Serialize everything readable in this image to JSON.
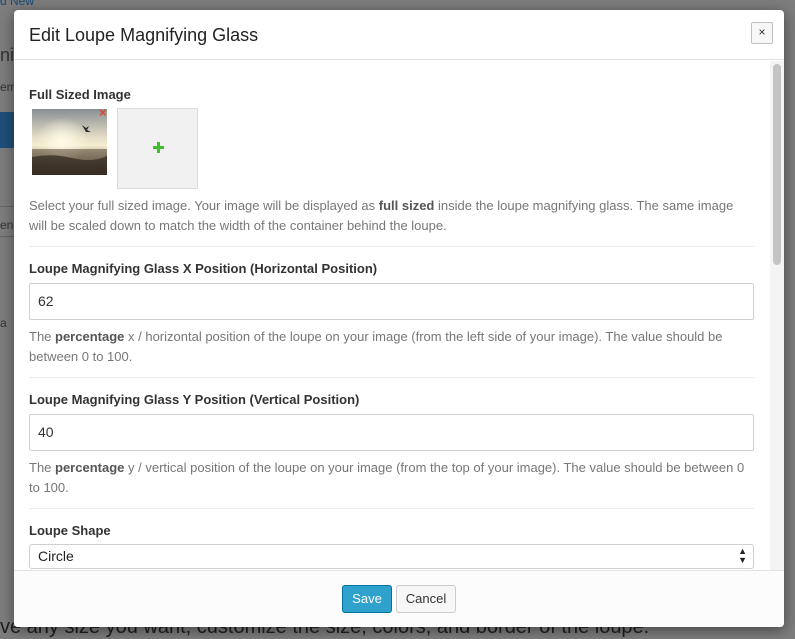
{
  "background": {
    "link_fragment": "d New",
    "fragments": [
      "ni",
      "em",
      "en",
      "a"
    ],
    "footer_text": "ve any size you want, customize the size, colors, and border of the loupe."
  },
  "modal": {
    "title": "Edit Loupe Magnifying Glass",
    "close_icon": "close-icon",
    "close_label": "×"
  },
  "image_section": {
    "label": "Full Sized Image",
    "remove_icon": "×",
    "description_parts": [
      "Select your full sized image. Your image will be displayed as ",
      "full sized",
      " inside the loupe magnifying glass. The same image will be scaled down to match the width of the container behind the loupe."
    ]
  },
  "x_position": {
    "label": "Loupe Magnifying Glass X Position (Horizontal Position)",
    "value": "62",
    "description_parts": [
      "The ",
      "percentage",
      " x / horizontal position of the loupe on your image (from the left side of your image). The value should be between 0 to 100."
    ]
  },
  "y_position": {
    "label": "Loupe Magnifying Glass Y Position (Vertical Position)",
    "value": "40",
    "description_parts": [
      "The ",
      "percentage",
      " y / vertical position of the loupe on your image (from the top of your image). The value should be between 0 to 100."
    ]
  },
  "shape": {
    "label": "Loupe Shape",
    "selected": "Circle"
  },
  "footer": {
    "save_label": "Save",
    "cancel_label": "Cancel"
  },
  "colors": {
    "primary_button": "#2ea2cc",
    "remove_icon": "#e0452b",
    "add_icon": "#3fbf2c"
  }
}
